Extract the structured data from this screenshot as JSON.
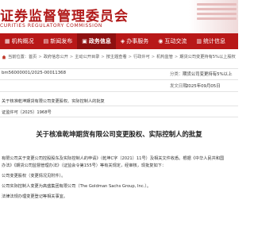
{
  "header": {
    "logo_cn": "证券监督管理委员会",
    "logo_en": "CURITIES REGULATORY COMMISSION"
  },
  "nav": {
    "items": [
      {
        "label": "机构概况",
        "icon": "institution-icon",
        "active": false
      },
      {
        "label": "新闻发布",
        "icon": "news-icon",
        "active": false
      },
      {
        "label": "政务信息",
        "icon": "gov-info-icon",
        "active": true
      },
      {
        "label": "办事服务",
        "icon": "service-icon",
        "active": false
      },
      {
        "label": "互动交流",
        "icon": "chat-icon",
        "active": false
      },
      {
        "label": "统计信息",
        "icon": "stats-icon",
        "active": false
      }
    ]
  },
  "breadcrumb": {
    "items": [
      "当前位置：首页",
      "政府信息公开",
      "主动公开目录",
      "按主题查看",
      "行政许可",
      "机构监管",
      "期货公司变更持有5%以上股权"
    ]
  },
  "meta": {
    "index_no": "bm56000001/2025-00011368",
    "subject_label": "分类：",
    "subject_value": "期货公司变更持有5%以上",
    "date_label": "发文日期：",
    "date_value": "2025年09月05日"
  },
  "doc_name_line": "关于核准乾坤期货有限公司变更股权、实际控制人的批复",
  "doc_number_line": "证监许可〔2025〕1968号",
  "doc_title": "关于核准乾坤期货有限公司变更股权、实际控制人的批复",
  "body": {
    "p1": "有限公司关于变更公司控股股东及实际控制人的申请》（乾坤C字〔2021〕11号）及相关文件收悉。根据《中华人民共和国",
    "p2": "办法》《期货公司监督管理办法》（证监会令第155号）等有关规定，经审核，现批复如下：",
    "p3": "公司变更股权（变更情况见附件）。",
    "p4": "公司实际控制人变更为高盛集团有限公司（The Goldman Sachs Group, Inc.）。",
    "p5": "法律法规办理变更登记等相关事宜。"
  }
}
